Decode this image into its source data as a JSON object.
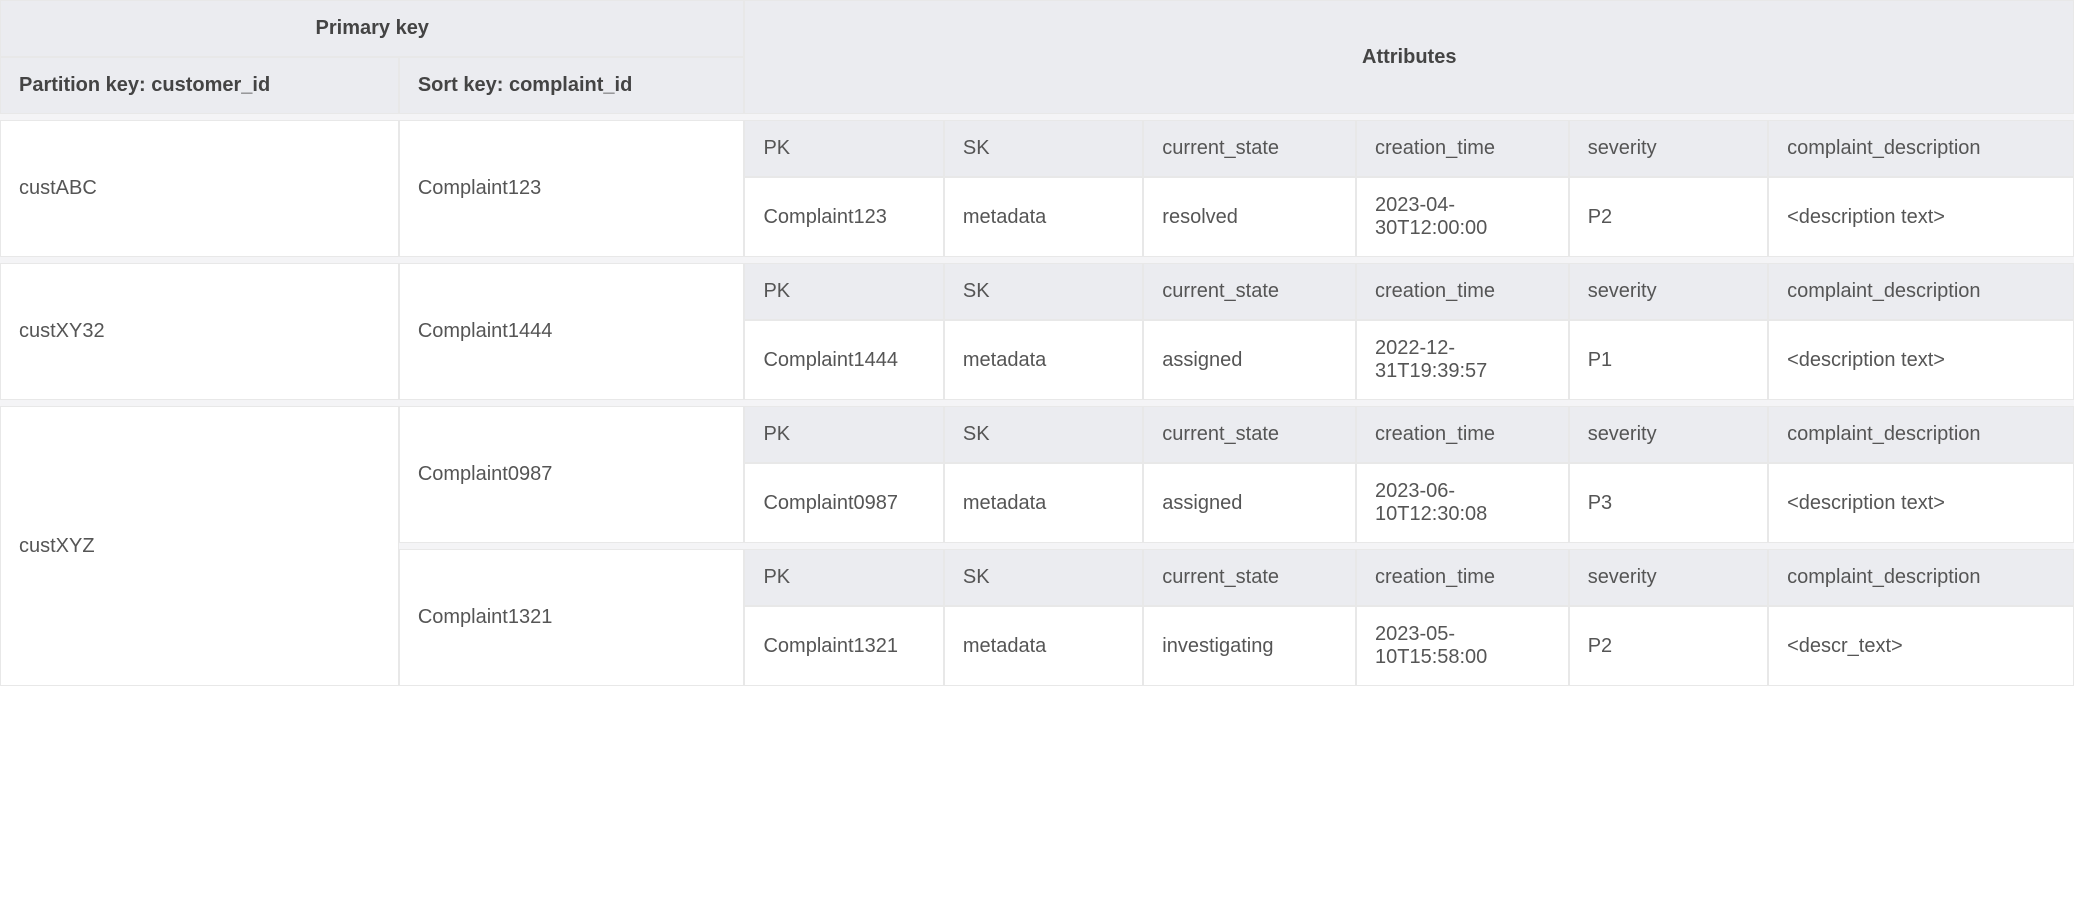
{
  "header": {
    "primary_key": "Primary key",
    "partition_key": "Partition key: customer_id",
    "sort_key": "Sort key: complaint_id",
    "attributes": "Attributes"
  },
  "attr_labels": {
    "pk": "PK",
    "sk": "SK",
    "current_state": "current_state",
    "creation_time": "creation_time",
    "severity": "severity",
    "complaint_description": "complaint_description"
  },
  "rows": [
    {
      "customer_id": "custABC",
      "complaint_id": "Complaint123",
      "pk": "Complaint123",
      "sk": "metadata",
      "current_state": "resolved",
      "creation_time": "2023-04-30T12:00:00",
      "severity": "P2",
      "complaint_description": "<description text>"
    },
    {
      "customer_id": "custXY32",
      "complaint_id": "Complaint1444",
      "pk": "Complaint1444",
      "sk": "metadata",
      "current_state": "assigned",
      "creation_time": "2022-12-31T19:39:57",
      "severity": "P1",
      "complaint_description": "<description text>"
    },
    {
      "customer_id": "custXYZ",
      "complaint_id": "Complaint0987",
      "pk": "Complaint0987",
      "sk": "metadata",
      "current_state": "assigned",
      "creation_time": "2023-06-10T12:30:08",
      "severity": "P3",
      "complaint_description": "<description text>"
    },
    {
      "customer_id": "custXYZ",
      "complaint_id": "Complaint1321",
      "pk": "Complaint1321",
      "sk": "metadata",
      "current_state": "investigating",
      "creation_time": "2023-05-10T15:58:00",
      "severity": "P2",
      "complaint_description": "<descr_text>"
    }
  ]
}
